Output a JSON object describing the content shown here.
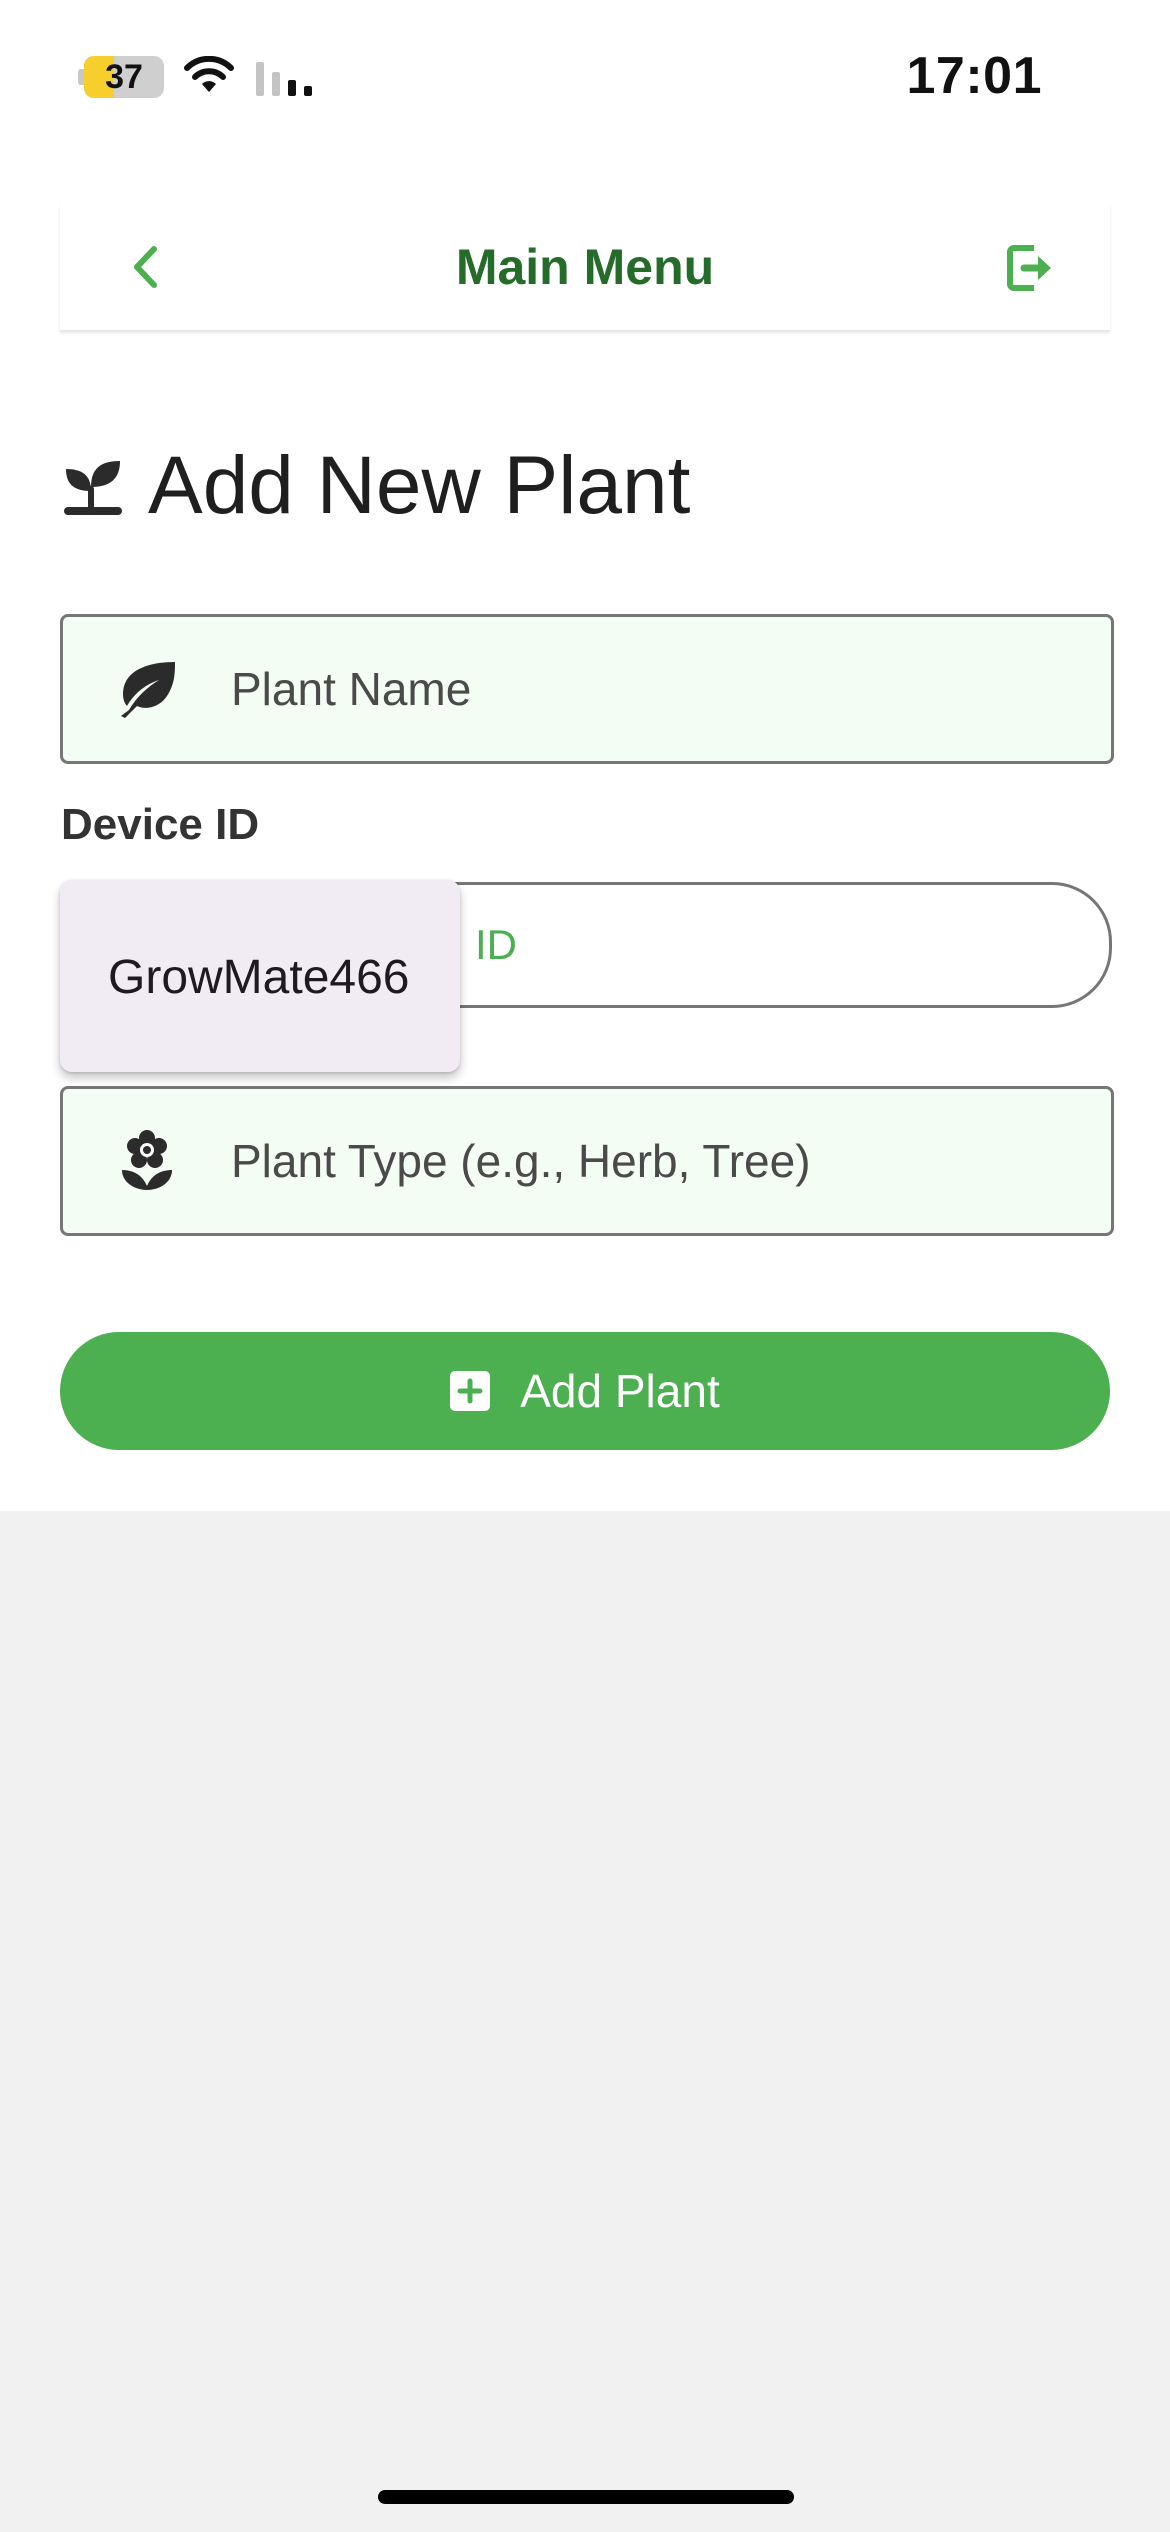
{
  "status_bar": {
    "battery_level": "37",
    "battery_fraction": 0.37,
    "time": "17:01",
    "icons": [
      "wifi-icon",
      "cellular-signal-icon"
    ]
  },
  "header": {
    "title": "Main Menu",
    "back_icon": "chevron-left-icon",
    "logout_icon": "sign-out-icon"
  },
  "page": {
    "title": "Add New Plant",
    "title_icon": "seedling-icon"
  },
  "form": {
    "plant_name": {
      "placeholder": "Plant Name",
      "icon": "leaf-icon"
    },
    "device": {
      "label": "Device ID",
      "placeholder": "ID",
      "options": [
        "GrowMate466"
      ]
    },
    "plant_type": {
      "placeholder": "Plant Type (e.g., Herb, Tree)",
      "icon": "flower-icon"
    },
    "submit_label": "Add Plant",
    "submit_icon": "plus-square-icon"
  },
  "colors": {
    "accent": "#4caf50",
    "header_title": "#256b2a",
    "input_background": "#f3fdf3",
    "menu_background": "#f1ecf3",
    "battery_fill": "#f6cf2c"
  }
}
